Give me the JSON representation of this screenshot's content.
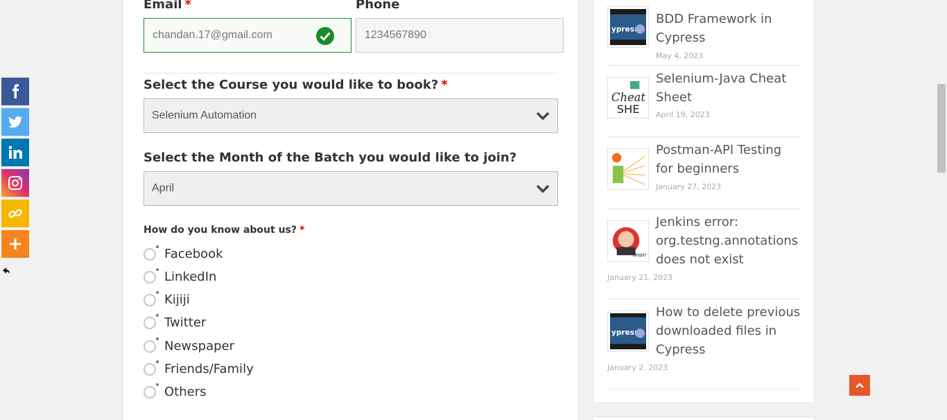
{
  "social": {
    "colors": {
      "facebook": "#3b5998",
      "twitter": "#55acee",
      "linkedin": "#0077b5",
      "instagram": "#c13584",
      "copy": "#f5b700",
      "more": "#f7831f"
    },
    "icons": [
      "facebook-icon",
      "twitter-icon",
      "linkedin-icon",
      "instagram-icon",
      "copy-link-icon",
      "more-icon"
    ]
  },
  "form": {
    "email": {
      "label": "Email",
      "required": "*",
      "value": "chandan.17@gmail.com"
    },
    "phone": {
      "label": "Phone",
      "placeholder": "1234567890"
    },
    "course": {
      "label": "Select the Course you would like to book?",
      "required": "*",
      "selected": "Selenium Automation"
    },
    "month": {
      "label": "Select the Month of the Batch you would like to join?",
      "selected": "April"
    },
    "source": {
      "label": "How do you know about us?",
      "required": "*",
      "options": [
        "Facebook",
        "LinkedIn",
        "Kijiji",
        "Twitter",
        "Newspaper",
        "Friends/Family",
        "Others"
      ]
    }
  },
  "sidebar": {
    "posts": [
      {
        "title": "BDD Framework in Cypress",
        "date": "May 4, 2023"
      },
      {
        "title": "Selenium-Java Cheat Sheet",
        "date": "April 19, 2023"
      },
      {
        "title": "Postman-API Testing for beginners",
        "date": "January 27, 2023"
      },
      {
        "title": "Jenkins error: org.testng.annotations does not exist",
        "date": "January 21, 2023"
      },
      {
        "title": "How to delete previous downloaded files in Cypress",
        "date": "January 2, 2023"
      }
    ]
  },
  "accent": "#e8552c",
  "valid_color": "#1b8a2c"
}
